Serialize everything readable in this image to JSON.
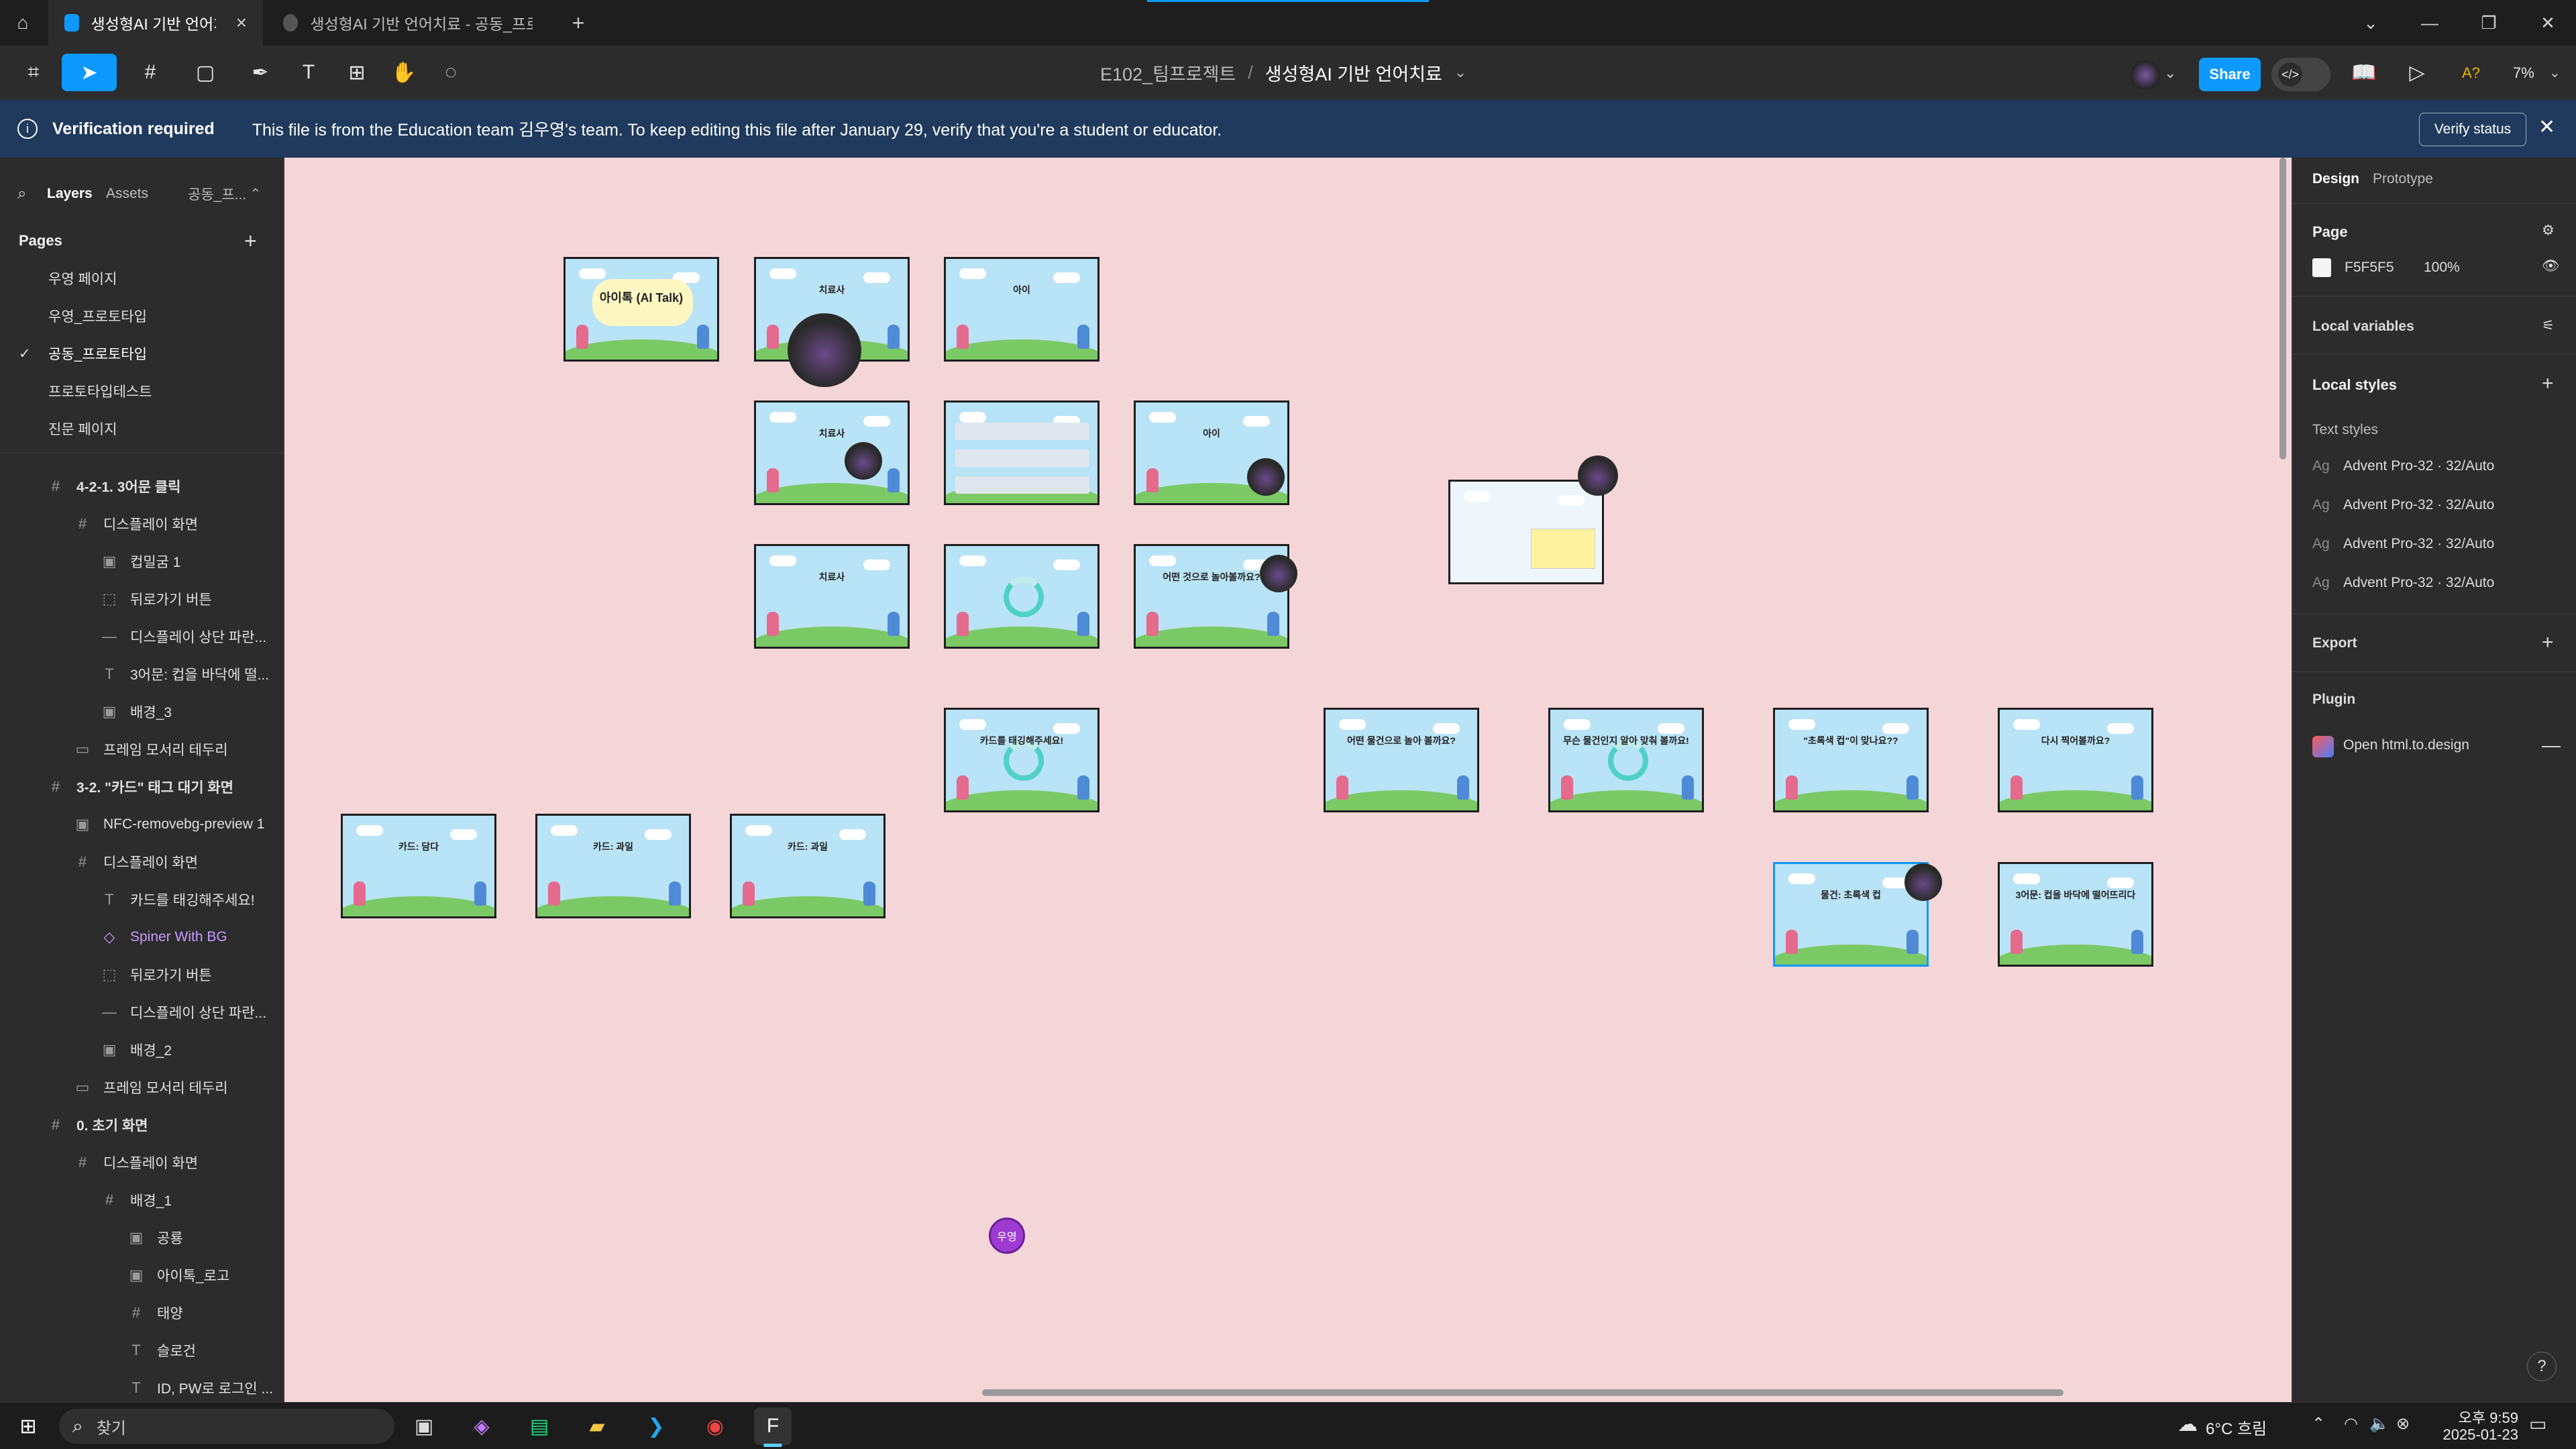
{
  "tabs": {
    "active": "생성형AI 기반 언어치료",
    "inactive": "생성형AI 기반 언어치료 - 공동_프로토타"
  },
  "toolbar": {
    "breadcrumb_project": "E102_팀프로젝트",
    "breadcrumb_sep": "/",
    "breadcrumb_file": "생성형AI 기반 언어치료",
    "share_label": "Share",
    "zoom": "7%",
    "presence_label": "A?"
  },
  "banner": {
    "title": "Verification required",
    "message": "This file is from the Education team 김우영's team. To keep editing this file after January 29, verify that you're a student or educator.",
    "button": "Verify status"
  },
  "left_panel": {
    "tabs": [
      "Layers",
      "Assets"
    ],
    "page_switch": "공동_프...",
    "pages_title": "Pages",
    "pages": [
      {
        "label": "우영 페이지",
        "selected": false
      },
      {
        "label": "우영_프로토타입",
        "selected": false
      },
      {
        "label": "공동_프로토타입",
        "selected": true
      },
      {
        "label": "프로토타입테스트",
        "selected": false
      },
      {
        "label": "진문 페이지",
        "selected": false
      }
    ],
    "layers": [
      {
        "label": "4-2-1. 3어문 클릭",
        "icon": "#",
        "indent": 0,
        "bold": true
      },
      {
        "label": "디스플레이 화면",
        "icon": "#",
        "indent": 1
      },
      {
        "label": "컵밀굼 1",
        "icon": "▣",
        "indent": 2
      },
      {
        "label": "뒤로가기 버튼",
        "icon": "⬚",
        "indent": 2
      },
      {
        "label": "디스플레이 상단 파란...",
        "icon": "—",
        "indent": 2
      },
      {
        "label": "3어문: 컵을 바닥에 떨...",
        "icon": "T",
        "indent": 2
      },
      {
        "label": "배경_3",
        "icon": "▣",
        "indent": 2
      },
      {
        "label": "프레임 모서리 테두리",
        "icon": "▭",
        "indent": 1
      },
      {
        "label": "3-2. \"카드\" 태그 대기 화면",
        "icon": "#",
        "indent": 0,
        "bold": true
      },
      {
        "label": "NFC-removebg-preview 1",
        "icon": "▣",
        "indent": 1
      },
      {
        "label": "디스플레이 화면",
        "icon": "#",
        "indent": 1
      },
      {
        "label": "카드를 태깅해주세요!",
        "icon": "T",
        "indent": 2
      },
      {
        "label": "Spiner With BG",
        "icon": "◇",
        "indent": 2,
        "component": true
      },
      {
        "label": "뒤로가기 버튼",
        "icon": "⬚",
        "indent": 2
      },
      {
        "label": "디스플레이 상단 파란...",
        "icon": "—",
        "indent": 2
      },
      {
        "label": "배경_2",
        "icon": "▣",
        "indent": 2
      },
      {
        "label": "프레임 모서리 테두리",
        "icon": "▭",
        "indent": 1
      },
      {
        "label": "0. 초기 화면",
        "icon": "#",
        "indent": 0,
        "bold": true
      },
      {
        "label": "디스플레이 화면",
        "icon": "#",
        "indent": 1
      },
      {
        "label": "배경_1",
        "icon": "#",
        "indent": 2
      },
      {
        "label": "공룡",
        "icon": "▣",
        "indent": 3
      },
      {
        "label": "아이톡_로고",
        "icon": "▣",
        "indent": 3
      },
      {
        "label": "태양",
        "icon": "#",
        "indent": 3
      },
      {
        "label": "슬로건",
        "icon": "T",
        "indent": 3
      },
      {
        "label": "ID, PW로 로그인 ...",
        "icon": "T",
        "indent": 3
      }
    ]
  },
  "right_panel": {
    "tabs": [
      "Design",
      "Prototype"
    ],
    "page_label": "Page",
    "page_color": "F5F5F5",
    "page_opacity": "100%",
    "local_variables": "Local variables",
    "local_styles": "Local styles",
    "text_styles_label": "Text styles",
    "text_styles": [
      "Advent Pro-32 · 32/Auto",
      "Advent Pro-32 · 32/Auto",
      "Advent Pro-32 · 32/Auto",
      "Advent Pro-32 · 32/Auto"
    ],
    "export_label": "Export",
    "plugin_label": "Plugin",
    "plugin_item": "Open html.to.design"
  },
  "canvas": {
    "bg_color": "#f5d6d8",
    "cursor_label": "우영",
    "frames": [
      {
        "title": "아이톡 (AI Talk)",
        "variant": "logo"
      },
      {
        "title": "치료사",
        "variant": "plain"
      },
      {
        "title": "아이",
        "variant": "plain"
      },
      {
        "title": "치료사",
        "variant": "plain"
      },
      {
        "title": "",
        "variant": "list"
      },
      {
        "title": "아이",
        "variant": "plain"
      },
      {
        "title": "치료사",
        "variant": "plain"
      },
      {
        "title": "",
        "variant": "ring"
      },
      {
        "title": "어떤 것으로 놀아볼까요?",
        "variant": "plain"
      },
      {
        "title": "",
        "variant": "chart"
      },
      {
        "title": "카드를 태깅해주세요!",
        "variant": "ring"
      },
      {
        "title": "어떤 물건으로 놀아 볼까요?",
        "variant": "plain"
      },
      {
        "title": "무슨 물건인지 알아 맞춰 볼까요!",
        "variant": "ring"
      },
      {
        "title": "\"초록색 컵\"이 맞나요??",
        "variant": "plain"
      },
      {
        "title": "다시 찍어볼까요?",
        "variant": "plain"
      },
      {
        "title": "카드: 담다",
        "variant": "plain"
      },
      {
        "title": "카드: 과일",
        "variant": "plain"
      },
      {
        "title": "카드: 과일",
        "variant": "plain"
      },
      {
        "title": "물건: 초록색 컵",
        "variant": "plain"
      },
      {
        "title": "3어문: 컵을 바닥에 떨어뜨리다",
        "variant": "plain"
      }
    ]
  },
  "taskbar": {
    "search_placeholder": "찾기",
    "weather": "6°C 흐림",
    "time": "오후 9:59",
    "date": "2025-01-23"
  },
  "colors": {
    "accent": "#0d99ff",
    "banner": "#1f3a5c",
    "panel": "#2c2c2c",
    "canvas": "#f5d6d8"
  }
}
